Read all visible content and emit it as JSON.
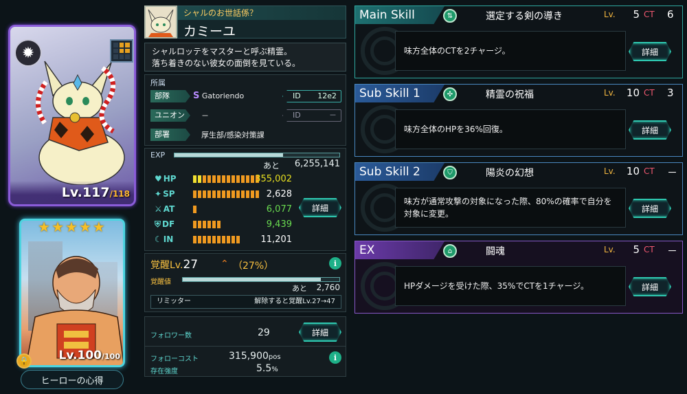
{
  "character": {
    "title": "シャルのお世話係？",
    "name": "カミーユ",
    "description_lines": [
      "シャルロッテをマスターと呼ぶ精霊。",
      "落ち着きのない彼女の面倒を見ている。"
    ],
    "level": "Lv.117",
    "level_max": "/118"
  },
  "hero_card": {
    "stars": [
      "★",
      "★",
      "★",
      "★",
      "★"
    ],
    "level": "Lv.100",
    "level_max": "/100",
    "button_label": "ヒーローの心得"
  },
  "affiliation": {
    "header": "所属",
    "squad_label": "部隊",
    "squad_mark": "S",
    "squad_value": "Gatoriendo",
    "squad_id_label": "ID",
    "squad_id_value": "12e2",
    "union_label": "ユニオン",
    "union_value": "－",
    "union_id_label": "ID",
    "union_id_value": "－",
    "dept_label": "部署",
    "dept_value": "厚生部/感染対策課"
  },
  "stats": {
    "exp_label": "EXP",
    "exp_fill": 0.66,
    "remaining_label": "あと",
    "remaining_value": "6,255,141",
    "rows": [
      {
        "label": "HP",
        "value": "355,002",
        "color": "#e8e020",
        "bars": 14,
        "yellow": 2
      },
      {
        "label": "SP",
        "value": "2,628",
        "color": "#ffffff",
        "bars": 14,
        "yellow": 0
      },
      {
        "label": "AT",
        "value": "6,077",
        "color": "#6adc50",
        "bars": 1,
        "yellow": 0
      },
      {
        "label": "DF",
        "value": "9,439",
        "color": "#6adc50",
        "bars": 6,
        "yellow": 0
      },
      {
        "label": "IN",
        "value": "11,201",
        "color": "#ffffff",
        "bars": 10,
        "yellow": 0
      }
    ],
    "detail_label": "詳細"
  },
  "awakening": {
    "label": "覚醒Lv.",
    "level": "27",
    "percent_open": "（",
    "percent": "27%",
    "percent_close": "）",
    "value_label": "覚醒値",
    "value_fill": 0.88,
    "remaining_label": "あと",
    "remaining_value": "2,760",
    "limiter_label": "リミッター",
    "limiter_value": "解除すると覚醒Lv.27→47",
    "info": "i"
  },
  "follow": {
    "followers_label": "フォロワー数",
    "followers_value": "29",
    "detail_label": "詳細",
    "cost_label": "フォローコスト",
    "cost_value": "315,900",
    "cost_unit": "pos",
    "strength_label": "存在強度",
    "strength_value": "5.5",
    "strength_unit": "%",
    "info": "i"
  },
  "skills": [
    {
      "type": "Main Skill",
      "name": "選定する剣の導き",
      "lv_label": "Lv.",
      "lv": "5",
      "ct_label": "CT",
      "ct": "6",
      "desc": "味方全体のCTを2チャージ。",
      "detail": "詳細",
      "theme": "green"
    },
    {
      "type": "Sub Skill 1",
      "name": "精霊の祝福",
      "lv_label": "Lv.",
      "lv": "10",
      "ct_label": "CT",
      "ct": "3",
      "desc": "味方全体のHPを36%回復。",
      "detail": "詳細",
      "theme": "blue"
    },
    {
      "type": "Sub Skill 2",
      "name": "陽炎の幻想",
      "lv_label": "Lv.",
      "lv": "10",
      "ct_label": "CT",
      "ct": "－",
      "desc": "味方が通常攻撃の対象になった際、80%の確率で自分を対象に変更。",
      "detail": "詳細",
      "theme": "blue"
    },
    {
      "type": "EX",
      "name": "闘魂",
      "lv_label": "Lv.",
      "lv": "5",
      "ct_label": "CT",
      "ct": "－",
      "desc": "HPダメージを受けた際、35%でCTを1チャージ。",
      "detail": "詳細",
      "theme": "purple"
    }
  ]
}
